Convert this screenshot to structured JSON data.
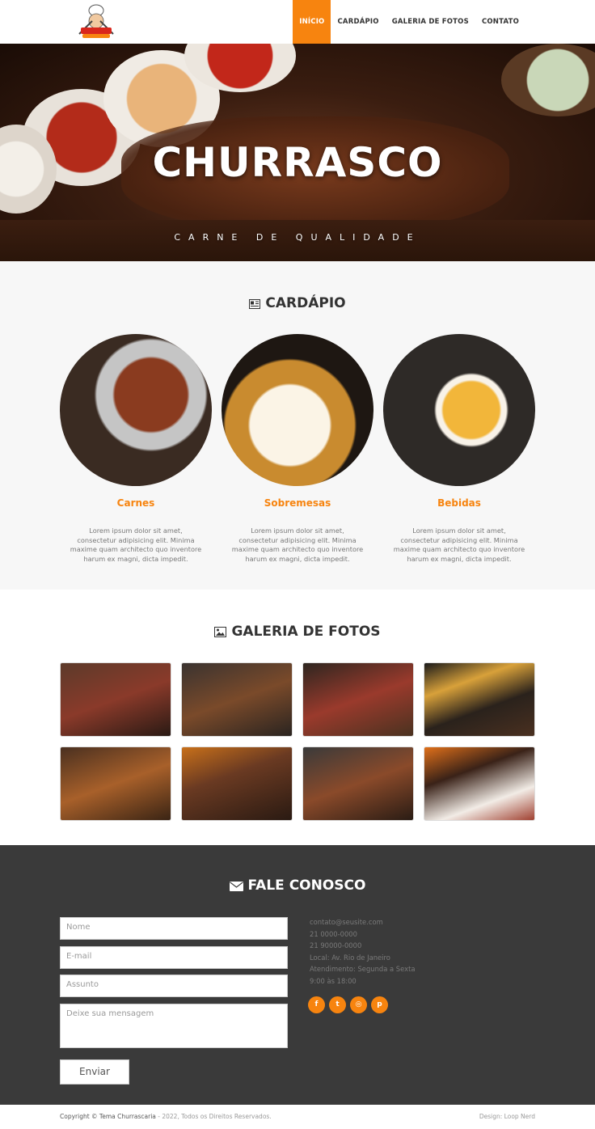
{
  "header": {
    "logo_text": "Churrascaria",
    "nav": [
      {
        "label": "INÍCIO",
        "active": true
      },
      {
        "label": "CARDÁPIO",
        "active": false
      },
      {
        "label": "GALERIA DE FOTOS",
        "active": false
      },
      {
        "label": "CONTATO",
        "active": false
      }
    ]
  },
  "hero": {
    "title": "CHURRASCO",
    "subtitle": "CARNE DE QUALIDADE"
  },
  "cardapio": {
    "title": "CARDÁPIO",
    "icon": "menu-icon",
    "items": [
      {
        "name": "Carnes",
        "desc": "Lorem ipsum dolor sit amet, consectetur adipisicing elit. Minima maxime quam architecto quo inventore harum ex magni, dicta impedit."
      },
      {
        "name": "Sobremesas",
        "desc": "Lorem ipsum dolor sit amet, consectetur adipisicing elit. Minima maxime quam architecto quo inventore harum ex magni, dicta impedit."
      },
      {
        "name": "Bebidas",
        "desc": "Lorem ipsum dolor sit amet, consectetur adipisicing elit. Minima maxime quam architecto quo inventore harum ex magni, dicta impedit."
      }
    ]
  },
  "galeria": {
    "title": "GALERIA DE FOTOS",
    "icon": "image-icon"
  },
  "contato": {
    "title": "FALE CONOSCO",
    "icon": "envelope-icon",
    "placeholders": {
      "nome": "Nome",
      "email": "E-mail",
      "assunto": "Assunto",
      "mensagem": "Deixe sua mensagem"
    },
    "send_label": "Enviar",
    "info": [
      "contato@seusite.com",
      "21 0000-0000",
      "21 90000-0000",
      "Local: Av. Rio de Janeiro",
      "Atendimento: Segunda a Sexta",
      "9:00 às 18:00"
    ],
    "socials": [
      {
        "name": "facebook-icon",
        "glyph": "f"
      },
      {
        "name": "twitter-icon",
        "glyph": "t"
      },
      {
        "name": "instagram-icon",
        "glyph": "◎"
      },
      {
        "name": "pinterest-icon",
        "glyph": "p"
      }
    ]
  },
  "footer": {
    "copyright_strong": "Copyright © Tema Churrascaria",
    "copyright_rest": " - 2022, Todos os Direitos Reservados.",
    "design": "Design: Loop Nerd"
  },
  "colors": {
    "accent": "#f7840f",
    "dark": "#3a3a3a"
  }
}
